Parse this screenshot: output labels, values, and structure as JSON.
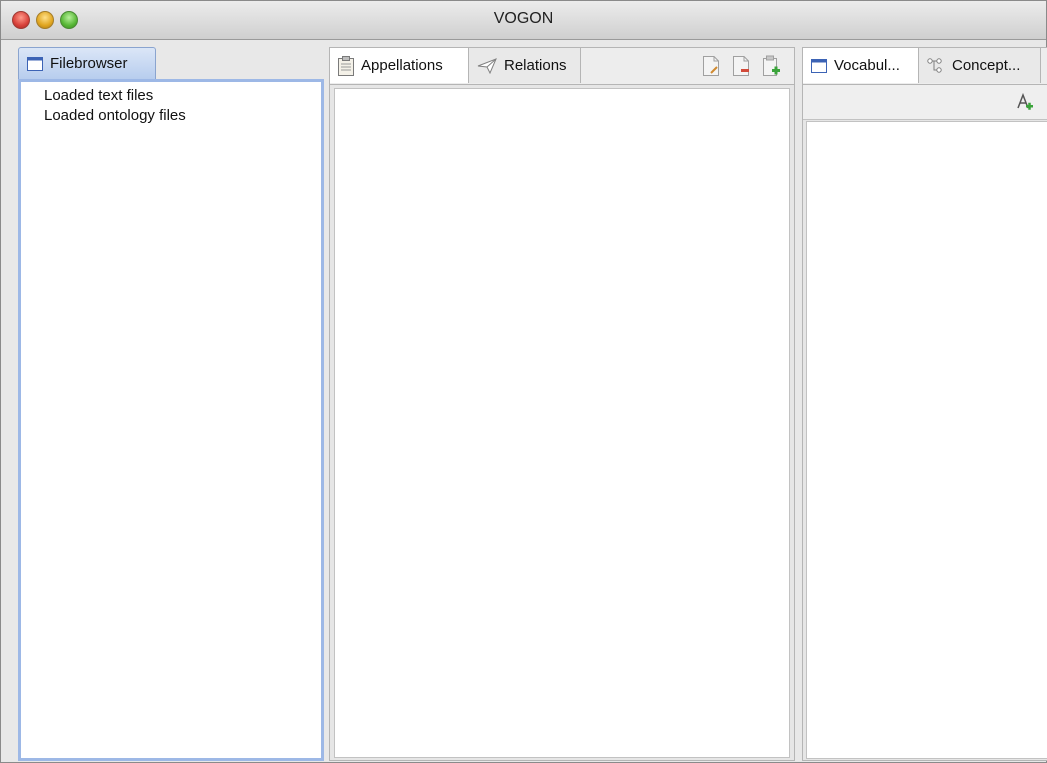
{
  "window": {
    "title": "VOGON"
  },
  "left_panel": {
    "tab_label": "Filebrowser",
    "tree_items": [
      {
        "label": "Loaded text files"
      },
      {
        "label": "Loaded ontology files"
      }
    ]
  },
  "middle_panel": {
    "tabs": [
      {
        "label": "Appellations",
        "icon": "clipboard-icon",
        "active": true
      },
      {
        "label": "Relations",
        "icon": "paper-plane-icon",
        "active": false
      }
    ],
    "toolbar_icons": [
      "edit-document-icon",
      "remove-document-icon",
      "add-document-icon"
    ]
  },
  "right_panel": {
    "tabs": [
      {
        "label": "Vocabul...",
        "icon": "window-icon",
        "active": true
      },
      {
        "label": "Concept...",
        "icon": "hierarchy-icon",
        "active": false
      }
    ],
    "toolbar_icons": [
      "add-concept-icon"
    ]
  },
  "colors": {
    "active_tab_blue": "#b7cdee",
    "panel_border_blue": "#9db8e6",
    "close": "#d8413a",
    "minimize": "#e0a51f",
    "maximize": "#57b736"
  }
}
